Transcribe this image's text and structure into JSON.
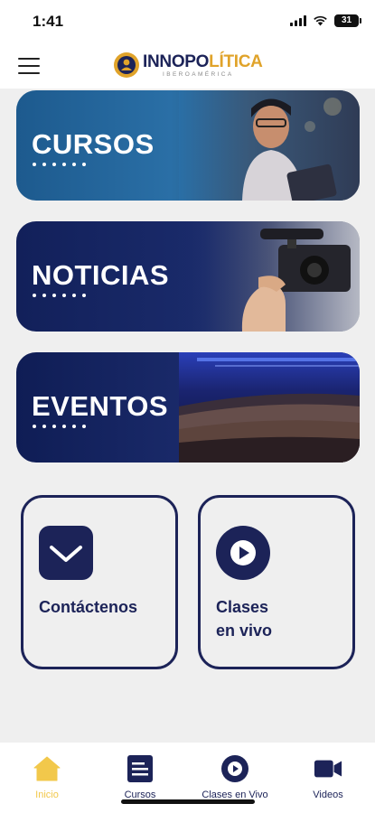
{
  "status_bar": {
    "time": "1:41",
    "battery": "31"
  },
  "header": {
    "logo_part1": "INNOPO",
    "logo_part2": "LÍTICA",
    "logo_sub": "IBEROAMÉRICA"
  },
  "banners": [
    {
      "title": "CURSOS"
    },
    {
      "title": "NOTICIAS"
    },
    {
      "title": "EVENTOS"
    }
  ],
  "cards": {
    "contact": {
      "label": "Contáctenos",
      "icon": "mail-icon"
    },
    "live": {
      "label": "Clases\nen vivo",
      "icon": "play-icon"
    }
  },
  "bottom_nav": [
    {
      "label": "Inicio",
      "icon": "home-icon",
      "active": true
    },
    {
      "label": "Cursos",
      "icon": "document-icon",
      "active": false
    },
    {
      "label": "Clases en Vivo",
      "icon": "play-icon",
      "active": false
    },
    {
      "label": "Videos",
      "icon": "video-camera-icon",
      "active": false
    }
  ],
  "colors": {
    "primary": "#1c2358",
    "accent": "#e0a32a",
    "active_nav": "#f2c84b",
    "background": "#efefef"
  }
}
